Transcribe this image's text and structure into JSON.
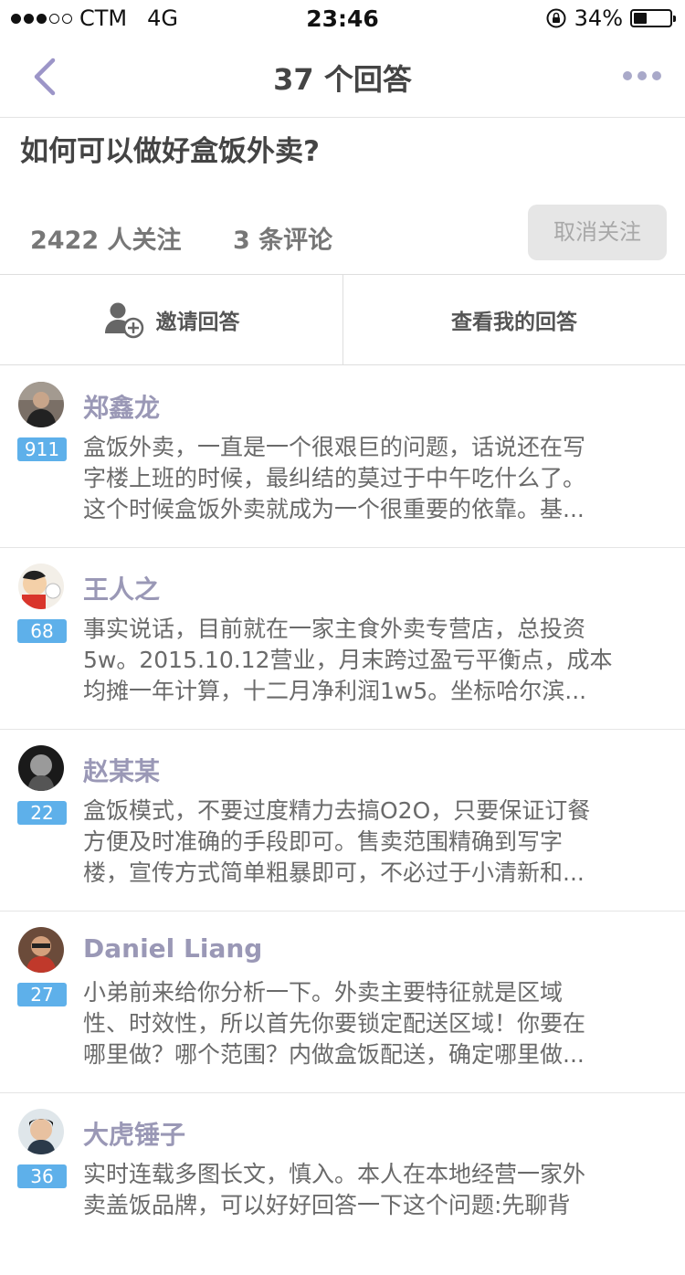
{
  "status_bar": {
    "carrier": "CTM",
    "network": "4G",
    "time": "23:46",
    "battery": "34%",
    "signal_dots_filled": 3,
    "signal_dots_total": 5
  },
  "nav": {
    "title": "37 个回答",
    "back_icon": "chevron-left-icon",
    "more_icon": "more-horizontal-icon"
  },
  "question": {
    "title": "如何可以做好盒饭外卖?",
    "followers": "2422 人关注",
    "comments": "3 条评论",
    "unfollow_label": "取消关注"
  },
  "actions": {
    "invite_label": "邀请回答",
    "view_mine_label": "查看我的回答"
  },
  "colors": {
    "accent_author": "#9a98b6",
    "vote_badge": "#5eb0ea",
    "back_chevron": "#9c95c8"
  },
  "answers": [
    {
      "author": "郑鑫龙",
      "votes": "911",
      "lines": [
        "盒饭外卖，一直是一个很艰巨的问题，话说还在写",
        "字楼上班的时候，最纠结的莫过于中午吃什么了。",
        "这个时候盒饭外卖就成为一个很重要的依靠。基..."
      ]
    },
    {
      "author": "王人之",
      "votes": "68",
      "lines": [
        "事实说话，目前就在一家主食外卖专营店，总投资",
        "5w。2015.10.12营业，月末跨过盈亏平衡点，成本",
        "均摊一年计算，十二月净利润1w5。坐标哈尔滨..."
      ]
    },
    {
      "author": "赵某某",
      "votes": "22",
      "lines": [
        "盒饭模式，不要过度精力去搞O2O，只要保证订餐",
        "方便及时准确的手段即可。售卖范围精确到写字",
        "楼，宣传方式简单粗暴即可，不必过于小清新和..."
      ]
    },
    {
      "author": "Daniel Liang",
      "votes": "27",
      "lines": [
        "小弟前来给你分析一下。外卖主要特征就是区域",
        "性、时效性，所以首先你要锁定配送区域！你要在",
        "哪里做？哪个范围？内做盒饭配送，确定哪里做..."
      ]
    },
    {
      "author": "大虎锤子",
      "votes": "36",
      "lines": [
        "实时连载多图长文，慎入。本人在本地经营一家外",
        "卖盖饭品牌，可以好好回答一下这个问题:先聊背"
      ]
    }
  ]
}
